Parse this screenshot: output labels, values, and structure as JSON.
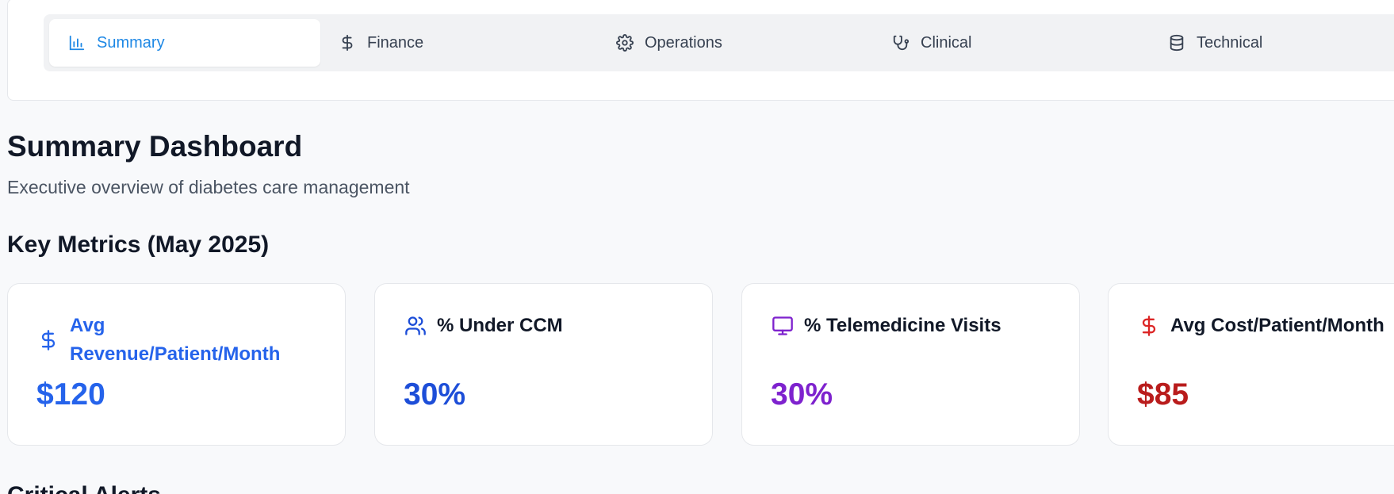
{
  "tabs": [
    {
      "label": "Summary",
      "icon": "bar-chart-icon",
      "active": true
    },
    {
      "label": "Finance",
      "icon": "dollar-icon",
      "active": false
    },
    {
      "label": "Operations",
      "icon": "gear-icon",
      "active": false
    },
    {
      "label": "Clinical",
      "icon": "stethoscope-icon",
      "active": false
    },
    {
      "label": "Technical",
      "icon": "database-icon",
      "active": false
    }
  ],
  "page": {
    "title": "Summary Dashboard",
    "subtitle": "Executive overview of diabetes care management"
  },
  "key_metrics": {
    "title": "Key Metrics (May 2025)",
    "cards": [
      {
        "label": "Avg Revenue/Patient/Month",
        "value": "$120",
        "icon": "dollar-icon",
        "color": "#2563eb"
      },
      {
        "label": "% Under CCM",
        "value": "30%",
        "icon": "users-icon",
        "color": "#1d4ed8"
      },
      {
        "label": "% Telemedicine Visits",
        "value": "30%",
        "icon": "monitor-icon",
        "color": "#7e22ce"
      },
      {
        "label": "Avg Cost/Patient/Month",
        "value": "$85",
        "icon": "dollar-icon",
        "color": "#b91c1c"
      }
    ]
  },
  "next_section": {
    "title": "Critical Alerts"
  },
  "colors": {
    "accent": "#1e88e5",
    "card_border": "#e5e7eb",
    "background": "#f8f9fb"
  }
}
